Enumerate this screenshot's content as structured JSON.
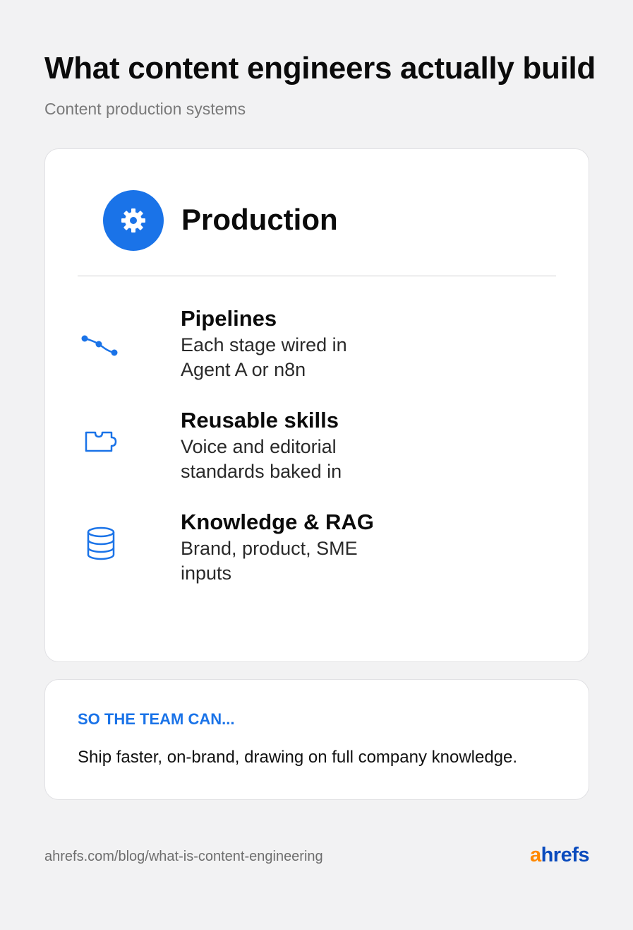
{
  "header": {
    "title": "What content engineers actually build",
    "subtitle": "Content production systems"
  },
  "section": {
    "icon": "gear-icon",
    "title": "Production",
    "items": [
      {
        "icon": "pipeline-icon",
        "title": "Pipelines",
        "desc_line1": "Each stage wired in",
        "desc_line2": "Agent A or n8n"
      },
      {
        "icon": "puzzle-piece-icon",
        "title": "Reusable skills",
        "desc_line1": "Voice and editorial",
        "desc_line2": "standards baked in"
      },
      {
        "icon": "database-icon",
        "title": "Knowledge & RAG",
        "desc_line1": "Brand, product, SME",
        "desc_line2": "inputs"
      }
    ]
  },
  "summary": {
    "label": "SO THE TEAM CAN...",
    "text": "Ship faster, on-brand, drawing on full company knowledge."
  },
  "footer": {
    "url": "ahrefs.com/blog/what-is-content-engineering",
    "logo_first": "a",
    "logo_rest": "hrefs"
  },
  "colors": {
    "accent": "#1a73e8",
    "background": "#f2f2f3",
    "logo_orange": "#ff8800",
    "logo_blue": "#0a4bbd"
  }
}
